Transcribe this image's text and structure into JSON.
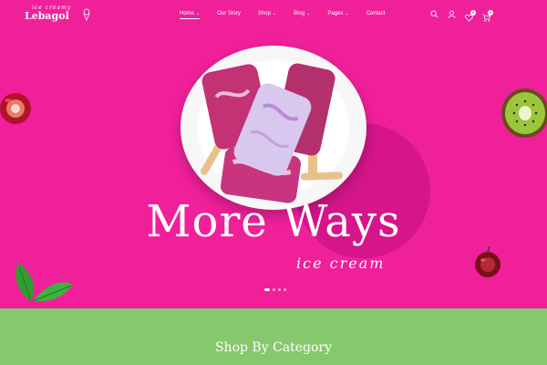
{
  "brand": {
    "tagline": "ice creamy",
    "name": "Lebagol"
  },
  "nav": [
    {
      "label": "Home",
      "dropdown": true,
      "active": true
    },
    {
      "label": "Our Story",
      "dropdown": false
    },
    {
      "label": "Shop",
      "dropdown": true
    },
    {
      "label": "Blog",
      "dropdown": true
    },
    {
      "label": "Pages",
      "dropdown": true
    },
    {
      "label": "Contact",
      "dropdown": false
    }
  ],
  "header_icons": {
    "search": "search-icon",
    "account": "user-icon",
    "wishlist": {
      "icon": "heart-icon",
      "count": "0"
    },
    "cart": {
      "icon": "cart-icon",
      "count": "0"
    }
  },
  "hero": {
    "headline": "More Ways",
    "subline": "ice cream",
    "slides_total": 4,
    "active_slide": 1
  },
  "section": {
    "title": "Shop By Category"
  },
  "colors": {
    "hero_bg": "#f0209b",
    "band_bg": "#86c96d",
    "accent_circle": "#d6158a"
  }
}
